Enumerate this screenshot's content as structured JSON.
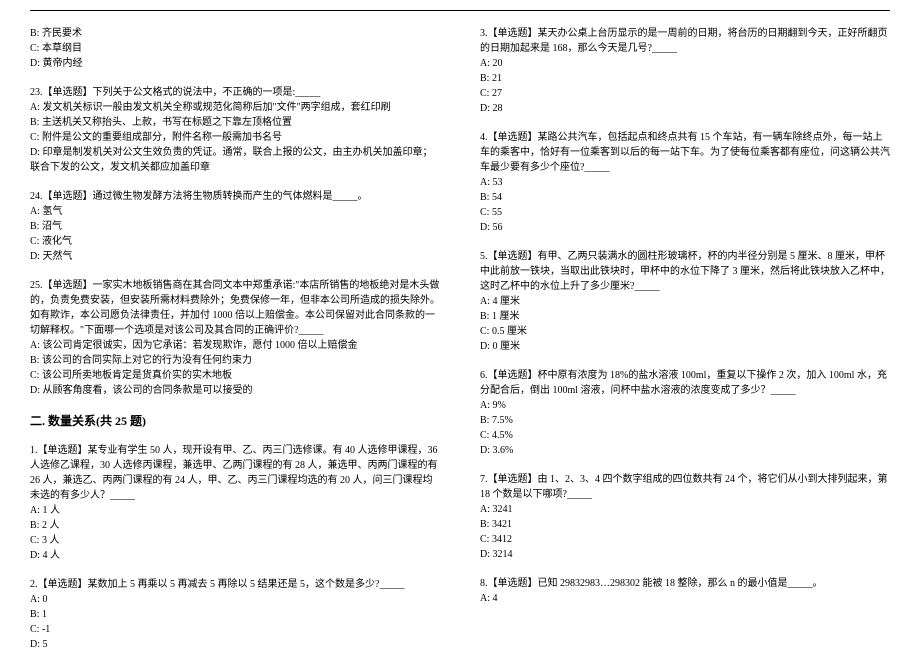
{
  "left": {
    "q22_opts": {
      "b": "B: 齐民要术",
      "c": "C: 本草纲目",
      "d": "D: 黄帝内经"
    },
    "q23": {
      "stem": "23.【单选题】下列关于公文格式的说法中，不正确的一项是:_____",
      "a": "A: 发文机关标识一般由发文机关全称或规范化简称后加\"文件\"两字组成，套红印刷",
      "b": "B: 主送机关又称抬头、上款，书写在标题之下靠左顶格位置",
      "c": "C: 附件是公文的重要组成部分，附件名称一般需加书名号",
      "d": "D: 印章是制发机关对公文生效负责的凭证。通常，联合上报的公文，由主办机关加盖印章；联合下发的公文，发文机关都应加盖印章"
    },
    "q24": {
      "stem": "24.【单选题】通过微生物发酵方法将生物质转换而产生的气体燃料是_____。",
      "a": "A: 氢气",
      "b": "B: 沼气",
      "c": "C: 液化气",
      "d": "D: 天然气"
    },
    "q25": {
      "stem": "25.【单选题】一家实木地板销售商在其合同文本中郑重承诺:\"本店所销售的地板绝对是木头做的，负责免费安装，但安装所需材料费除外；免费保修一年，但非本公司所造成的损失除外。如有欺诈，本公司愿负法律责任，并加付 1000 倍以上赔偿金。本公司保留对此合同条款的一切解释权。\"下面哪一个选项是对该公司及其合同的正确评价?_____",
      "a": "A: 该公司肯定很诚实，因为它承诺：若发现欺诈，愿付 1000 倍以上赔偿金",
      "b": "B: 该公司的合同实际上对它的行为没有任何约束力",
      "c": "C: 该公司所卖地板肯定是货真价实的实木地板",
      "d": "D: 从顾客角度看，该公司的合同条款是可以接受的"
    },
    "section2": "二. 数量关系(共 25 题)",
    "q1": {
      "stem": "1.【单选题】某专业有学生 50 人，现开设有甲、乙、丙三门选修课。有 40 人选修甲课程，36 人选修乙课程，30 人选修丙课程，兼选甲、乙两门课程的有 28 人，兼选甲、丙两门课程的有 26 人，兼选乙、丙两门课程的有 24 人，甲、乙、丙三门课程均选的有 20 人，问三门课程均未选的有多少人？_____",
      "a": "A: 1 人",
      "b": "B: 2 人",
      "c": "C: 3 人",
      "d": "D: 4 人"
    },
    "q2": {
      "stem": "2.【单选题】某数加上 5 再乘以 5 再减去 5 再除以 5 结果还是 5，这个数是多少?_____",
      "a": "A: 0",
      "b": "B: 1",
      "c": "C: -1",
      "d": "D: 5"
    }
  },
  "right": {
    "q3": {
      "stem": "3.【单选题】某天办公桌上台历显示的是一周前的日期，将台历的日期翻到今天，正好所翻页的日期加起来是 168，那么今天是几号?_____",
      "a": "A: 20",
      "b": "B: 21",
      "c": "C: 27",
      "d": "D: 28"
    },
    "q4": {
      "stem": "4.【单选题】某路公共汽车，包括起点和终点共有 15 个车站，有一辆车除终点外，每一站上车的乘客中，恰好有一位乘客到以后的每一站下车。为了使每位乘客都有座位，问这辆公共汽车最少要有多少个座位?_____",
      "a": "A: 53",
      "b": "B: 54",
      "c": "C: 55",
      "d": "D: 56"
    },
    "q5": {
      "stem": "5.【单选题】有甲、乙两只装满水的圆柱形玻璃杯，杯的内半径分别是 5 厘米、8 厘米，甲杯中此前放一铁块，当取出此铁块时，甲杯中的水位下降了 3 厘米，然后将此铁块放入乙杯中，这时乙杯中的水位上升了多少厘米?_____",
      "a": "A: 4 厘米",
      "b": "B: 1 厘米",
      "c": "C: 0.5 厘米",
      "d": "D: 0 厘米"
    },
    "q6": {
      "stem": "6.【单选题】杯中原有浓度为 18%的盐水溶液 100ml，重复以下操作 2 次，加入 100ml 水，充分配合后，倒出 100ml 溶液，问杯中盐水溶液的浓度变成了多少？_____",
      "a": "A: 9%",
      "b": "B: 7.5%",
      "c": "C: 4.5%",
      "d": "D: 3.6%"
    },
    "q7": {
      "stem": "7.【单选题】由 1、2、3、4 四个数字组成的四位数共有 24 个，将它们从小到大排列起来，第 18 个数是以下哪项?_____",
      "a": "A: 3241",
      "b": "B: 3421",
      "c": "C: 3412",
      "d": "D: 3214"
    },
    "q8": {
      "stem": "8.【单选题】已知 29832983…298302 能被 18 整除，那么 n 的最小值是_____。",
      "a": "A: 4"
    }
  }
}
